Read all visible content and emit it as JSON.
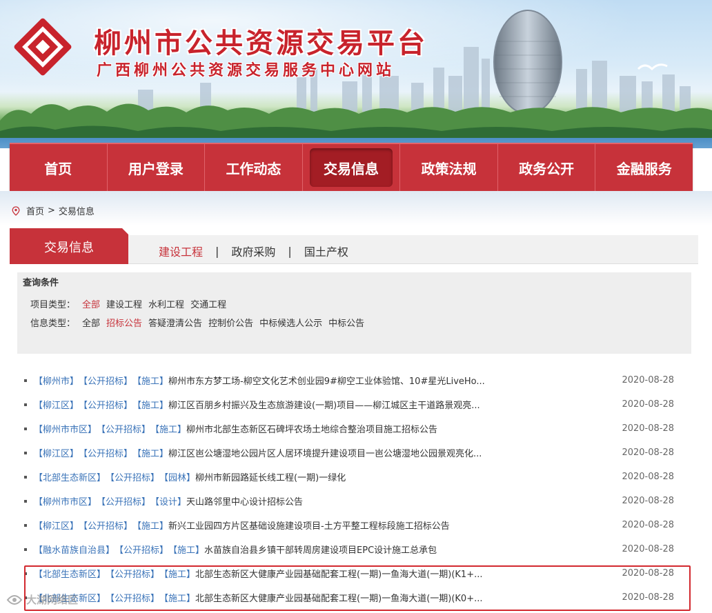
{
  "site": {
    "title": "柳州市公共资源交易平台",
    "subtitle": "广西柳州公共资源交易服务中心网站"
  },
  "nav": {
    "items": [
      {
        "label": "首页",
        "active": false
      },
      {
        "label": "用户登录",
        "active": false
      },
      {
        "label": "工作动态",
        "active": false
      },
      {
        "label": "交易信息",
        "active": true
      },
      {
        "label": "政策法规",
        "active": false
      },
      {
        "label": "政务公开",
        "active": false
      },
      {
        "label": "金融服务",
        "active": false
      }
    ]
  },
  "breadcrumb": {
    "home": "首页",
    "separator": ">",
    "current": "交易信息"
  },
  "section": {
    "title": "交易信息",
    "tabs": [
      "建设工程",
      "政府采购",
      "国土产权"
    ],
    "tab_separator": "|",
    "active_tab": "建设工程"
  },
  "filter": {
    "title": "查询条件",
    "project_type_label": "项目类型：",
    "project_types": [
      "全部",
      "建设工程",
      "水利工程",
      "交通工程"
    ],
    "project_type_selected": "全部",
    "info_type_label": "信息类型：",
    "info_types": [
      "全部",
      "招标公告",
      "答疑澄清公告",
      "控制价公告",
      "中标候选人公示",
      "中标公告"
    ],
    "info_type_selected": "招标公告"
  },
  "list": [
    {
      "region": "【柳州市】",
      "method": "【公开招标】",
      "category": "【施工】",
      "title": "柳州市东方梦工场-柳空文化艺术创业园9#柳空工业体验馆、10#星光LiveHo...",
      "date": "2020-08-28"
    },
    {
      "region": "【柳江区】",
      "method": "【公开招标】",
      "category": "【施工】",
      "title": "柳江区百朋乡村振兴及生态旅游建设(一期)项目——柳江城区主干道路景观亮...",
      "date": "2020-08-28"
    },
    {
      "region": "【柳州市市区】",
      "method": "【公开招标】",
      "category": "【施工】",
      "title": "柳州市北部生态新区石碑坪农场土地综合整治项目施工招标公告",
      "date": "2020-08-28"
    },
    {
      "region": "【柳江区】",
      "method": "【公开招标】",
      "category": "【施工】",
      "title": "柳江区岜公塘湿地公园片区人居环境提升建设项目一岜公塘湿地公园景观亮化...",
      "date": "2020-08-28"
    },
    {
      "region": "【北部生态新区】",
      "method": "【公开招标】",
      "category": "【园林】",
      "title": "柳州市新园路延长线工程(一期)一绿化",
      "date": "2020-08-28"
    },
    {
      "region": "【柳州市市区】",
      "method": "【公开招标】",
      "category": "【设计】",
      "title": "天山路邻里中心设计招标公告",
      "date": "2020-08-28"
    },
    {
      "region": "【柳江区】",
      "method": "【公开招标】",
      "category": "【施工】",
      "title": "新兴工业园四方片区基础设施建设项目-土方平整工程标段施工招标公告",
      "date": "2020-08-28"
    },
    {
      "region": "【融水苗族自治县】",
      "method": "【公开招标】",
      "category": "【施工】",
      "title": "水苗族自治县乡镇干部转周房建设项目EPC设计施工总承包",
      "date": "2020-08-28"
    },
    {
      "region": "【北部生态新区】",
      "method": "【公开招标】",
      "category": "【施工】",
      "title": "北部生态新区大健康产业园基础配套工程(一期)一鱼海大道(一期)(K1+...",
      "date": "2020-08-28"
    },
    {
      "region": "【北部生态新区】",
      "method": "【公开招标】",
      "category": "【施工】",
      "title": "北部生态新区大健康产业园基础配套工程(一期)一鱼海大道(一期)(K0+...",
      "date": "2020-08-28"
    }
  ],
  "watermark": "大湖网络区",
  "colors": {
    "brand_red": "#c7323a",
    "tag_blue": "#3a73b8",
    "highlight_red": "#d2282e"
  }
}
